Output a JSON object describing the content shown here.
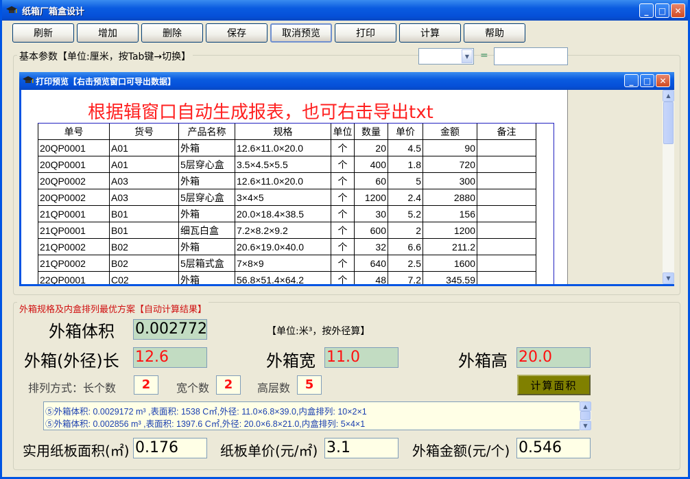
{
  "window": {
    "title": "纸箱厂箱盒设计"
  },
  "toolbar": {
    "buttons": [
      "刷新",
      "增加",
      "删除",
      "保存",
      "取消预览",
      "打印",
      "计算",
      "帮助"
    ]
  },
  "params": {
    "label": "基本参数【单位:厘米，按Tab键→切换】",
    "combo_value": "",
    "equals": "=",
    "result_value": ""
  },
  "preview": {
    "title": "打印预览【右击预览窗口可导出数据】",
    "report_title": "根据辑窗口自动生成报表，也可右击导出txt",
    "columns": [
      "单号",
      "货号",
      "产品名称",
      "规格",
      "单位",
      "数量",
      "单价",
      "金额",
      "备注"
    ],
    "rows": [
      [
        "20QP0001",
        "A01",
        "外箱",
        "12.6×11.0×20.0",
        "个",
        "20",
        "4.5",
        "90",
        ""
      ],
      [
        "20QP0001",
        "A01",
        "5层穿心盒",
        "3.5×4.5×5.5",
        "个",
        "400",
        "1.8",
        "720",
        ""
      ],
      [
        "20QP0002",
        "A03",
        "外箱",
        "12.6×11.0×20.0",
        "个",
        "60",
        "5",
        "300",
        ""
      ],
      [
        "20QP0002",
        "A03",
        "5层穿心盒",
        "3×4×5",
        "个",
        "1200",
        "2.4",
        "2880",
        ""
      ],
      [
        "21QP0001",
        "B01",
        "外箱",
        "20.0×18.4×38.5",
        "个",
        "30",
        "5.2",
        "156",
        ""
      ],
      [
        "21QP0001",
        "B01",
        "细瓦白盒",
        "7.2×8.2×9.2",
        "个",
        "600",
        "2",
        "1200",
        ""
      ],
      [
        "21QP0002",
        "B02",
        "外箱",
        "20.6×19.0×40.0",
        "个",
        "32",
        "6.6",
        "211.2",
        ""
      ],
      [
        "21QP0002",
        "B02",
        "5层箱式盒",
        "7×8×9",
        "个",
        "640",
        "2.5",
        "1600",
        ""
      ],
      [
        "22QP0001",
        "C02",
        "外箱",
        "56.8×51.4×64.2",
        "个",
        "48",
        "7.2",
        "345.59",
        ""
      ]
    ]
  },
  "results": {
    "label": "外箱规格及内盒排列最优方案【自动计算结果】",
    "volume_label": "外箱体积",
    "volume_value": "0.002772",
    "unit_note": "【单位:米³，按外径算】",
    "length_label": "外箱(外径)长",
    "length_value": "12.6",
    "width_label": "外箱宽",
    "width_value": "11.0",
    "height_label": "外箱高",
    "height_value": "20.0",
    "arrange_label": "排列方式：长个数",
    "len_count": "2",
    "wid_label": "宽个数",
    "wid_count": "2",
    "hgt_label": "高层数",
    "hgt_count": "5",
    "calc_area_button": "计算面积",
    "memo_lines": [
      "⑤外箱体积: 0.0029172 m³ ,表面积: 1538 C㎡,外径: 11.0×6.8×39.0,内盒排列: 10×2×1",
      "⑤外箱体积: 0.002856 m³ ,表面积: 1397.6 C㎡,外径: 20.0×6.8×21.0,内盒排列: 5×4×1"
    ],
    "area_label": "实用纸板面积(㎡)",
    "area_value": "0.176",
    "price_label": "纸板单价(元/㎡)",
    "price_value": "3.1",
    "amount_label": "外箱金额(元/个)",
    "amount_value": "0.546"
  },
  "colors": {
    "accent": "#0054E3",
    "red": "#FF1010",
    "field_green": "#C2DCC2"
  },
  "icons": {
    "app": "graduation-cap-icon"
  }
}
